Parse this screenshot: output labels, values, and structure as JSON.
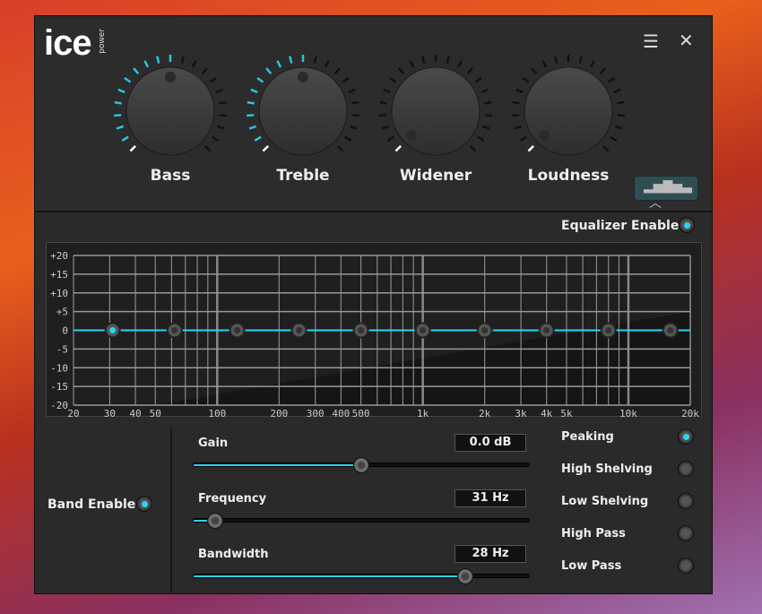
{
  "app": {
    "logo": "ice",
    "logo_sub": "power",
    "menu_icon": "hamburger-icon",
    "close_icon": "close-icon"
  },
  "accent": "#2ad4f5",
  "knobs": [
    {
      "label": "Bass",
      "value": 0.5
    },
    {
      "label": "Treble",
      "value": 0.5
    },
    {
      "label": "Widener",
      "value": 0
    },
    {
      "label": "Loudness",
      "value": 0
    }
  ],
  "eq_toggle_icon": "equalizer-bars-icon",
  "equalizer": {
    "enable_label": "Equalizer Enable",
    "enabled": true
  },
  "chart_data": {
    "type": "line",
    "x_scale": "log",
    "xlim": [
      20,
      20000
    ],
    "ylim": [
      -20,
      20
    ],
    "y_ticks": [
      "+20",
      "+15",
      "+10",
      "+5",
      "0",
      "-5",
      "-10",
      "-15",
      "-20"
    ],
    "x_ticks": [
      "20",
      "30",
      "40",
      "50",
      "100",
      "200",
      "300",
      "400",
      "500",
      "1k",
      "2k",
      "3k",
      "4k",
      "5k",
      "10k",
      "20k"
    ],
    "x_tick_values": [
      20,
      30,
      40,
      50,
      100,
      200,
      300,
      400,
      500,
      1000,
      2000,
      3000,
      4000,
      5000,
      10000,
      20000
    ],
    "bands": [
      {
        "f": 31,
        "g": 0,
        "selected": true
      },
      {
        "f": 62,
        "g": 0
      },
      {
        "f": 125,
        "g": 0
      },
      {
        "f": 250,
        "g": 0
      },
      {
        "f": 500,
        "g": 0
      },
      {
        "f": 1000,
        "g": 0
      },
      {
        "f": 2000,
        "g": 0
      },
      {
        "f": 4000,
        "g": 0
      },
      {
        "f": 8000,
        "g": 0
      },
      {
        "f": 16000,
        "g": 0
      }
    ]
  },
  "band": {
    "enable_label": "Band Enable",
    "enabled": true,
    "gain": {
      "label": "Gain",
      "value": "0.0 dB",
      "level": 0.5
    },
    "frequency": {
      "label": "Frequency",
      "value": "31 Hz",
      "level": 0.065
    },
    "bandwidth": {
      "label": "Bandwidth",
      "value": "28 Hz",
      "level": 0.81
    }
  },
  "filters": [
    {
      "label": "Peaking",
      "on": true
    },
    {
      "label": "High Shelving",
      "on": false
    },
    {
      "label": "Low Shelving",
      "on": false
    },
    {
      "label": "High Pass",
      "on": false
    },
    {
      "label": "Low Pass",
      "on": false
    }
  ]
}
